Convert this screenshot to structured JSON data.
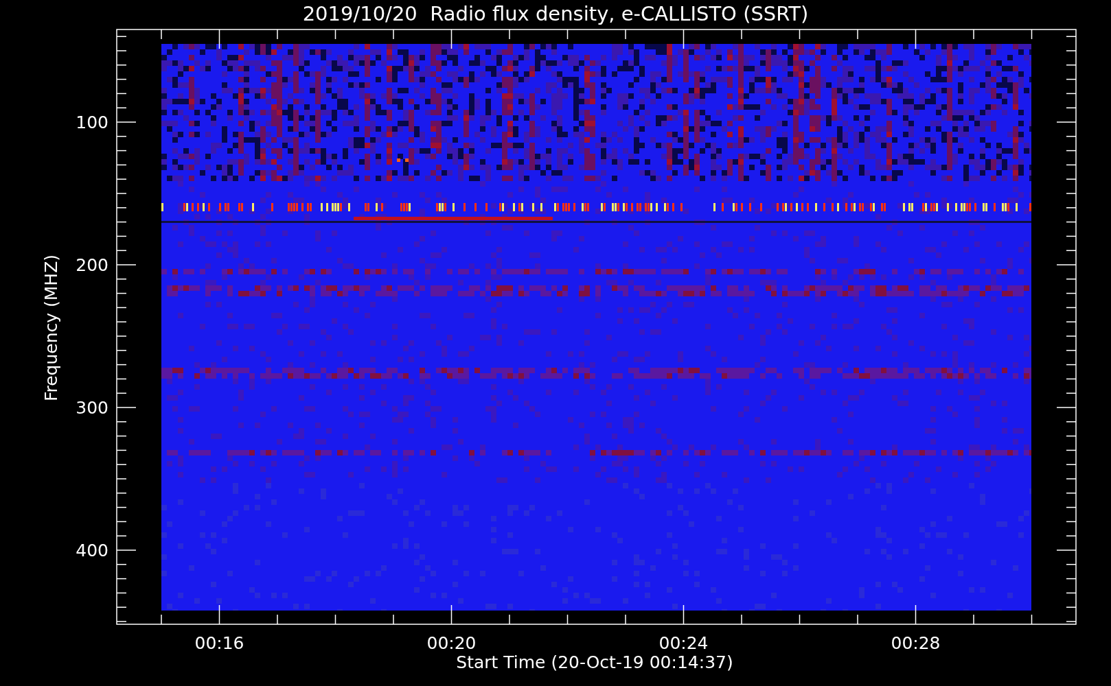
{
  "plot": {
    "title": "2019/10/20  Radio flux density, e-CALLISTO (SSRT)",
    "y_axis": {
      "label": "Frequency (MHZ)",
      "ticks": [
        "100",
        "200",
        "300",
        "400"
      ]
    },
    "x_axis": {
      "label": "Start Time (20-Oct-19 00:14:37)",
      "ticks": [
        "00:16",
        "00:20",
        "00:24",
        "00:28"
      ]
    }
  }
}
